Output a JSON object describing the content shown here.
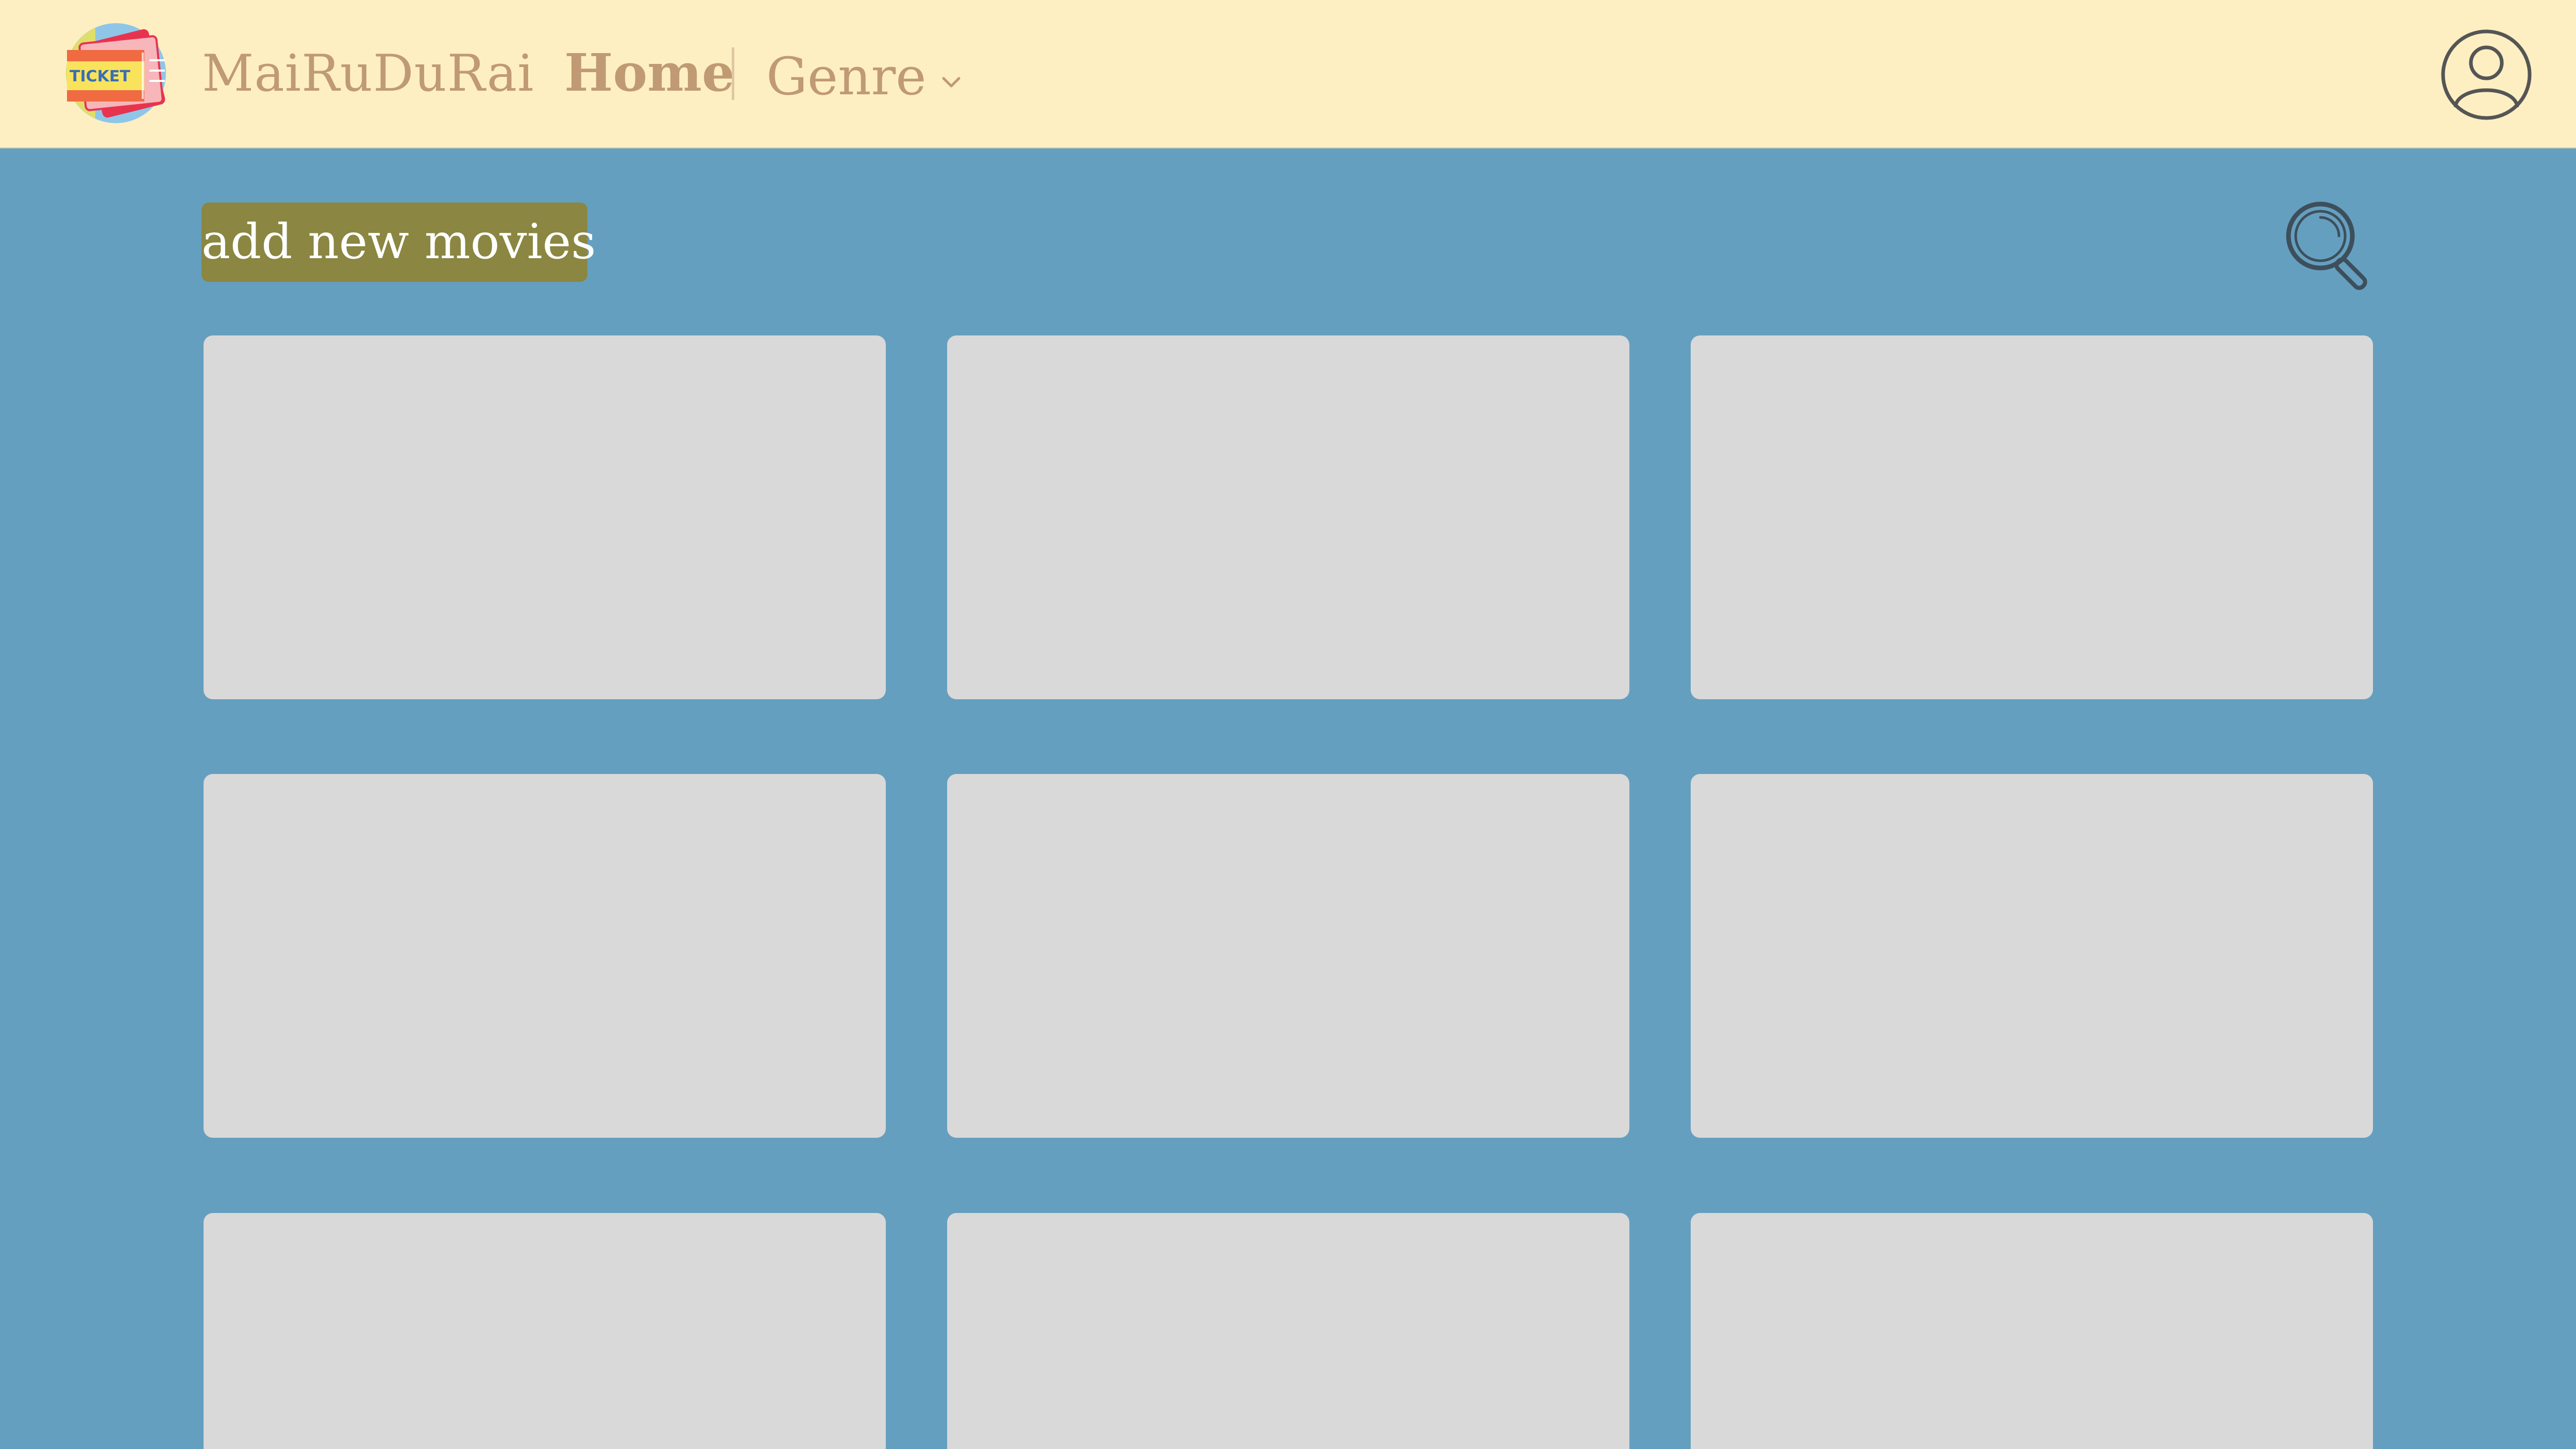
{
  "header": {
    "brand": "MaiRuDuRai",
    "logo_text": "TICKET",
    "nav": {
      "home": "Home",
      "genre": "Genre"
    },
    "icons": {
      "logo": "ticket-logo-icon",
      "genre_dropdown": "chevron-down-icon",
      "user": "user-account-icon"
    }
  },
  "toolbar": {
    "add_button": "add new movies",
    "search_icon": "search-icon"
  },
  "movies": {
    "columns": 3,
    "cards_visible": 9
  },
  "colors": {
    "header_bg": "#fdefc2",
    "page_bg": "#659fbf",
    "brand_text": "#c09a72",
    "add_button_bg": "#8b8641",
    "card_placeholder": "#d9d9d9",
    "icon_stroke": "#555555"
  }
}
